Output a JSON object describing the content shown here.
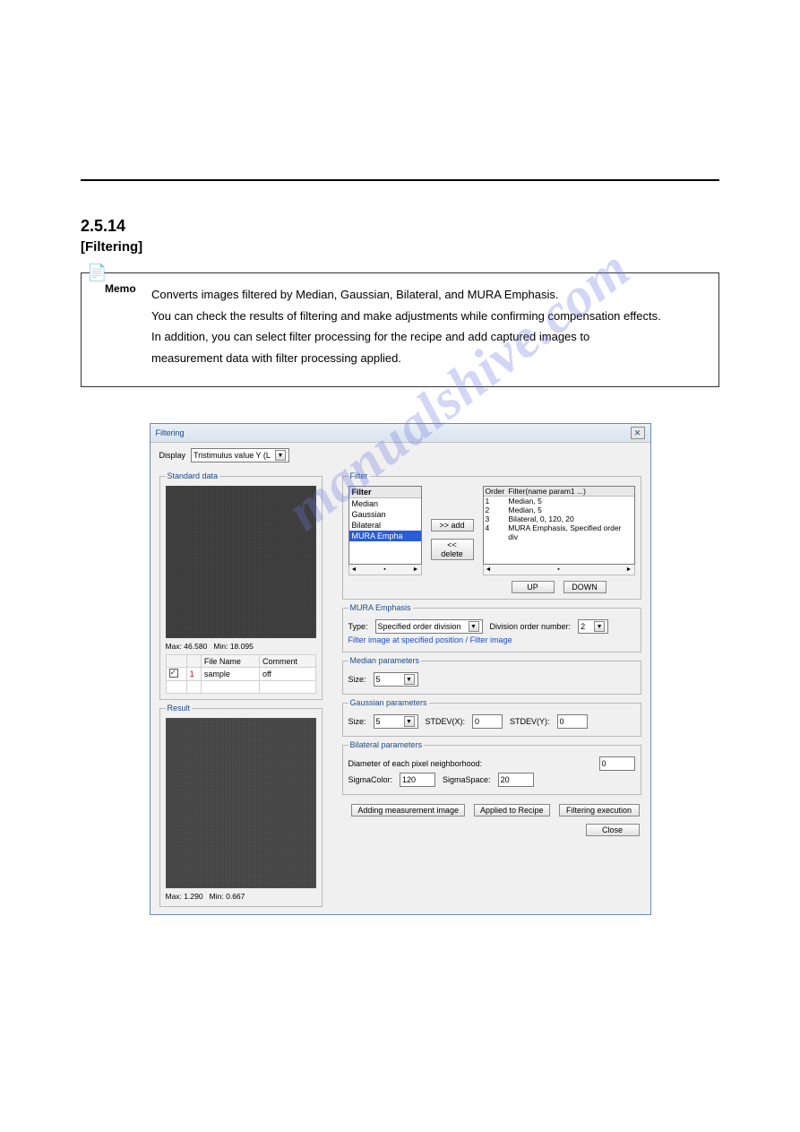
{
  "page": {
    "hr": true,
    "section_number": "2.5.14",
    "section_title": "[Filtering]",
    "memo_label": "Memo",
    "memo_lines": {
      "l1": "Converts images filtered by Median, Gaussian, Bilateral, and MURA Emphasis.",
      "l2": "You can check the results of filtering and make adjustments while confirming compensation effects.",
      "l3": "In addition, you can select filter processing for the recipe and add captured images to",
      "l4": "measurement data with filter processing applied."
    }
  },
  "dialog": {
    "title": "Filtering",
    "close_glyph": "✕",
    "display_label": "Display",
    "display_value": "Tristimulus value Y (L",
    "standard": {
      "legend": "Standard data",
      "max_label": "Max:",
      "max": "46.580",
      "min_label": "Min:",
      "min": "18.095",
      "headers": {
        "c1": "",
        "c2": "",
        "c3": "File Name",
        "c4": "Comment"
      },
      "row": {
        "idx": "1",
        "name": "sample",
        "comment": "off"
      }
    },
    "result": {
      "legend": "Result",
      "max_label": "Max:",
      "max": "1.290",
      "min_label": "Min:",
      "min": "0.667"
    },
    "filter": {
      "legend": "Filter",
      "list_header": "Filter",
      "items": {
        "i1": "Median",
        "i2": "Gaussian",
        "i3": "Bilateral",
        "i4": "MURA Empha"
      },
      "add_btn": ">> add",
      "delete_btn": "<< delete",
      "queue_headers": {
        "order": "Order",
        "name": "Filter(name param1 ...)"
      },
      "queue": {
        "r1": {
          "o": "1",
          "t": "Median,  5"
        },
        "r2": {
          "o": "2",
          "t": "Median,  5"
        },
        "r3": {
          "o": "3",
          "t": "Bilateral,  0,  120,  20"
        },
        "r4": {
          "o": "4",
          "t": "MURA Emphasis, Specified order div"
        }
      },
      "up_btn": "UP",
      "down_btn": "DOWN"
    },
    "mura": {
      "legend": "MURA Emphasis",
      "type_label": "Type:",
      "type_value": "Specified order division",
      "order_label": "Division order number:",
      "order_value": "2",
      "link_text": "Filter image at specified position / Filter image"
    },
    "median": {
      "legend": "Median parameters",
      "size_label": "Size:",
      "size_value": "5"
    },
    "gaussian": {
      "legend": "Gaussian parameters",
      "size_label": "Size:",
      "size_value": "5",
      "stdx_label": "STDEV(X):",
      "stdx_value": "0",
      "stdy_label": "STDEV(Y):",
      "stdy_value": "0"
    },
    "bilateral": {
      "legend": "Bilateral parameters",
      "diameter_label": "Diameter of each pixel neighborhood:",
      "diameter_value": "0",
      "sigmacolor_label": "SigmaColor:",
      "sigmacolor_value": "120",
      "sigmaspace_label": "SigmaSpace:",
      "sigmaspace_value": "20"
    },
    "buttons": {
      "add_meas": "Adding measurement image",
      "apply_recipe": "Applied to Recipe",
      "exec": "Filtering execution",
      "close": "Close"
    },
    "scroll": {
      "left": "◄",
      "right": "►",
      "thumb": "▪"
    }
  },
  "watermark": "manualshive.com"
}
